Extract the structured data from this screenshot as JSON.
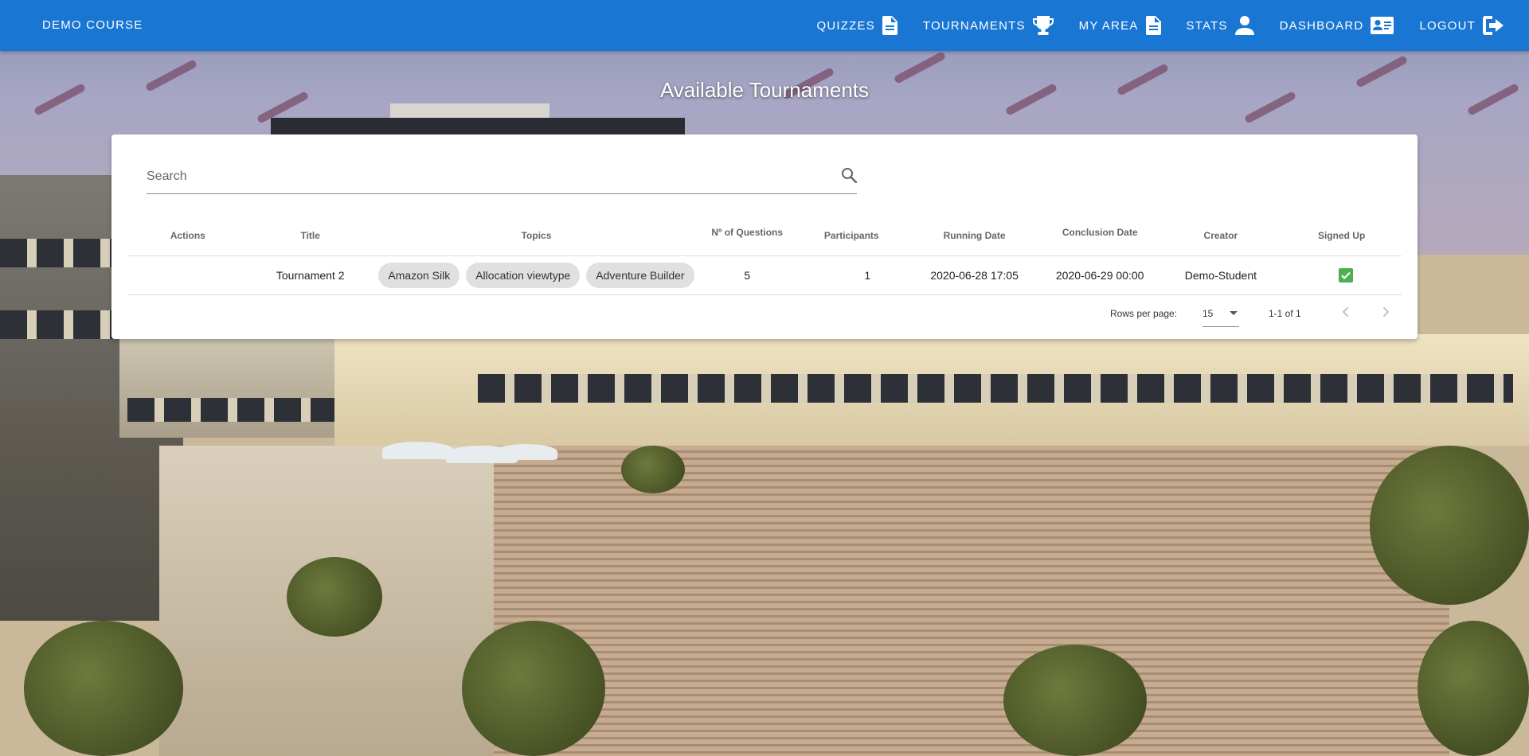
{
  "app": {
    "brand": "DEMO COURSE"
  },
  "nav": {
    "items": [
      {
        "label": "QUIZZES",
        "icon": "file-document-icon"
      },
      {
        "label": "TOURNAMENTS",
        "icon": "trophy-icon"
      },
      {
        "label": "MY AREA",
        "icon": "file-document-icon"
      },
      {
        "label": "STATS",
        "icon": "account-icon"
      },
      {
        "label": "DASHBOARD",
        "icon": "id-card-icon"
      },
      {
        "label": "LOGOUT",
        "icon": "logout-icon"
      }
    ]
  },
  "page": {
    "title": "Available Tournaments"
  },
  "search": {
    "placeholder": "Search",
    "value": ""
  },
  "table": {
    "headers": {
      "actions": "Actions",
      "title": "Title",
      "topics": "Topics",
      "questions": "Nº of Questions",
      "participants": "Participants",
      "running_date": "Running Date",
      "conclusion_date": "Conclusion Date",
      "creator": "Creator",
      "signed_up": "Signed Up"
    },
    "rows": [
      {
        "title": "Tournament 2",
        "topics": [
          "Amazon Silk",
          "Allocation viewtype",
          "Adventure Builder"
        ],
        "questions": "5",
        "participants": "1",
        "running_date": "2020-06-28 17:05",
        "conclusion_date": "2020-06-29 00:00",
        "creator": "Demo-Student",
        "signed_up": true
      }
    ]
  },
  "pagination": {
    "rows_per_page_label": "Rows per page:",
    "rows_per_page": "15",
    "range": "1-1 of 1"
  },
  "colors": {
    "primary": "#1976d2",
    "signed_up": "#4caf50"
  }
}
